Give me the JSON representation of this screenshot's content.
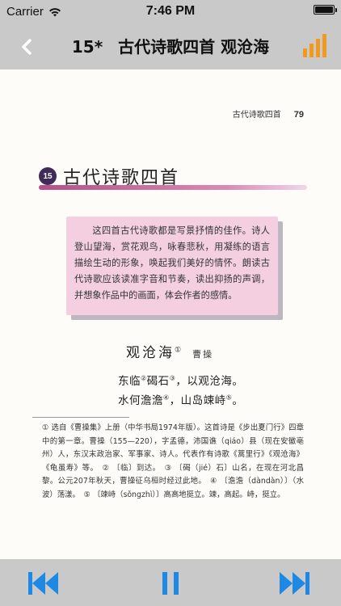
{
  "status_bar": {
    "carrier": "Carrier",
    "time": "7:46 PM",
    "battery_level": 1.0
  },
  "nav": {
    "lesson_number": "15*",
    "title": "古代诗歌四首 观沧海",
    "back_icon": "chevron-left-icon",
    "stats_icon": "bar-chart-icon",
    "accent_color": "#f29a1f"
  },
  "page": {
    "running_head": "古代诗歌四首",
    "page_number": "79",
    "lesson_badge": "15",
    "lesson_title": "古代诗歌四首",
    "intro": "这四首古代诗歌都是写景抒情的佳作。诗人登山望海，赏花观鸟，咏春悲秋，用凝练的语言描绘生动的形象，唤起我们美好的情怀。朗读古代诗歌应该读准字音和节奏，读出抑扬的声调，并想象作品中的画面，体会作者的感情。",
    "poem_title": "观沧海",
    "poem_title_note": "①",
    "poem_author": "曹操",
    "line1_a": "东临",
    "line1_n1": "②",
    "line1_b": "碣石",
    "line1_n2": "③",
    "line1_c": "，以观沧海。",
    "line2_a": "水何澹澹",
    "line2_n1": "④",
    "line2_b": "，山岛竦峙",
    "line2_n2": "⑤",
    "line2_c": "。",
    "footnotes": "① 选自《曹操集》上册（中华书局1974年版）。这首诗是《步出夏门行》四章中的第一章。曹操（155—220），字孟德，沛国谯（qiáo）县（现在安徽亳州）人，东汉末政治家、军事家、诗人。代表作有诗歌《蒿里行》《观沧海》《龟虽寿》等。　② 〔临〕到达。　③ 〔碣（jié）石〕山名，在现在河北昌黎。公元207年秋天，曹操征乌桓时经过此地。　④ 〔澹澹（dàndàn）〕（水波）荡漾。　⑤ 〔竦峙（sǒngzhì）〕高高地挺立。竦，高起。峙，挺立。"
  },
  "toolbar": {
    "prev_icon": "skip-previous-icon",
    "pause_icon": "pause-icon",
    "next_icon": "skip-next-icon",
    "color": "#1e88e5"
  }
}
